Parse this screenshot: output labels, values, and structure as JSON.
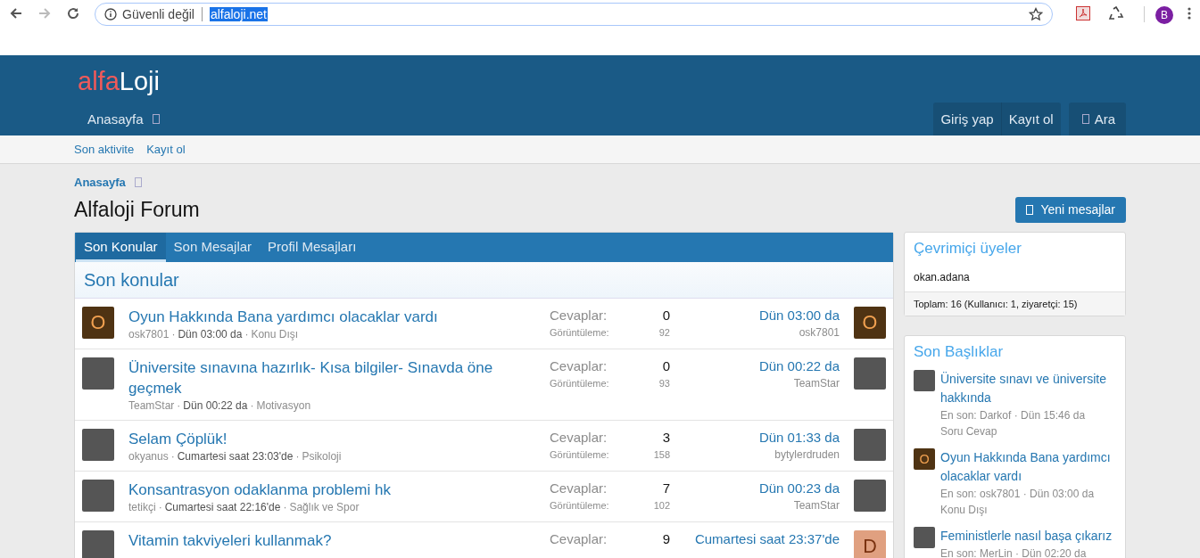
{
  "browser": {
    "forward_disabled": true,
    "security_label": "Güvenli değil",
    "url": "alfaloji.net",
    "url_selected": true,
    "profile_initial": "B"
  },
  "header": {
    "logo_parts": [
      {
        "text": "alfa",
        "kind": "accent"
      },
      {
        "text": "Loji",
        "kind": "plain"
      }
    ],
    "nav": [
      "Anasayfa"
    ],
    "actions": [
      "Giriş yap",
      "Kayıt ol"
    ],
    "search_label": "Ara"
  },
  "subnav": [
    "Son aktivite",
    "Kayıt ol"
  ],
  "breadcrumb": "Anasayfa",
  "page_title": "Alfaloji Forum",
  "new_posts_button": "Yeni mesajlar",
  "tabs": [
    {
      "label": "Son Konular",
      "selected": true
    },
    {
      "label": "Son Mesajlar",
      "selected": false
    },
    {
      "label": "Profil Mesajları",
      "selected": false
    }
  ],
  "section_title": "Son konular",
  "threads": [
    {
      "title": "Oyun Hakkında Bana yardımcı olacaklar vardı",
      "meta": [
        {
          "text": "osk7801",
          "kind": "author"
        },
        {
          "text": "·",
          "kind": "separator"
        },
        {
          "text": "Dün 03:00 da",
          "kind": "date"
        },
        {
          "text": "·",
          "kind": "separator"
        },
        {
          "text": "Konu Dışı",
          "kind": "forum"
        }
      ],
      "replies_label": "Cevaplar:",
      "replies": "0",
      "views_label": "Görüntüleme:",
      "views": "92",
      "last_date": "Dün 03:00 da",
      "last_user": "osk7801",
      "avatar": {
        "kind": "letter",
        "letter": "O",
        "color": "#4f3313"
      },
      "last_avatar": {
        "kind": "letter",
        "letter": "O",
        "color": "#4f3313"
      }
    },
    {
      "title": "Üniversite sınavına hazırlık- Kısa bilgiler- Sınavda öne geçmek",
      "meta": [
        {
          "text": "TeamStar",
          "kind": "author"
        },
        {
          "text": "·",
          "kind": "separator"
        },
        {
          "text": "Dün 00:22 da",
          "kind": "date"
        },
        {
          "text": "·",
          "kind": "separator"
        },
        {
          "text": "Motivasyon",
          "kind": "forum"
        }
      ],
      "replies_label": "Cevaplar:",
      "replies": "0",
      "views_label": "Görüntüleme:",
      "views": "93",
      "last_date": "Dün 00:22 da",
      "last_user": "TeamStar",
      "avatar": {
        "kind": "photo"
      },
      "last_avatar": {
        "kind": "photo"
      }
    },
    {
      "title": "Selam Çöplük!",
      "meta": [
        {
          "text": "okyanus",
          "kind": "author"
        },
        {
          "text": "·",
          "kind": "separator"
        },
        {
          "text": "Cumartesi saat 23:03'de",
          "kind": "date"
        },
        {
          "text": "·",
          "kind": "separator"
        },
        {
          "text": "Psikoloji",
          "kind": "forum"
        }
      ],
      "replies_label": "Cevaplar:",
      "replies": "3",
      "views_label": "Görüntüleme:",
      "views": "158",
      "last_date": "Dün 01:33 da",
      "last_user": "bytylerdruden",
      "avatar": {
        "kind": "photo"
      },
      "last_avatar": {
        "kind": "photo"
      }
    },
    {
      "title": "Konsantrasyon odaklanma problemi hk",
      "meta": [
        {
          "text": "tetikçi",
          "kind": "author"
        },
        {
          "text": "·",
          "kind": "separator"
        },
        {
          "text": "Cumartesi saat 22:16'de",
          "kind": "date"
        },
        {
          "text": "·",
          "kind": "separator"
        },
        {
          "text": "Sağlık ve Spor",
          "kind": "forum"
        }
      ],
      "replies_label": "Cevaplar:",
      "replies": "7",
      "views_label": "Görüntüleme:",
      "views": "102",
      "last_date": "Dün 00:23 da",
      "last_user": "TeamStar",
      "avatar": {
        "kind": "photo"
      },
      "last_avatar": {
        "kind": "photo"
      }
    },
    {
      "title": "Vitamin takviyeleri kullanmak?",
      "replies_label": "Cevaplar:",
      "replies": "9",
      "last_date": "Cumartesi saat 23:37'de",
      "avatar": {
        "kind": "photo"
      },
      "last_avatar": {
        "kind": "letter",
        "letter": "D",
        "color": "#e0a080"
      }
    }
  ],
  "online": {
    "title": "Çevrimiçi üyeler",
    "members": [
      "okan.adana"
    ],
    "footer": "Toplam: 16 (Kullanıcı: 1, ziyaretçi: 15)"
  },
  "latest": {
    "title": "Son Başlıklar",
    "items": [
      {
        "title": "Üniversite sınavı ve üniversite hakkında",
        "meta": "En son: Darkof · Dün 15:46 da",
        "forum": "Soru Cevap",
        "avatar": {
          "kind": "photo"
        }
      },
      {
        "title": "Oyun Hakkında Bana yardımcı olacaklar vardı",
        "meta": "En son: osk7801 · Dün 03:00 da",
        "forum": "Konu Dışı",
        "avatar": {
          "kind": "letter",
          "letter": "O",
          "color": "#4f3313"
        }
      },
      {
        "title": "Feministlerle nasıl başa çıkarız",
        "meta": "En son: MerLin · Dün 02:20 da",
        "avatar": {
          "kind": "photo"
        }
      }
    ]
  }
}
